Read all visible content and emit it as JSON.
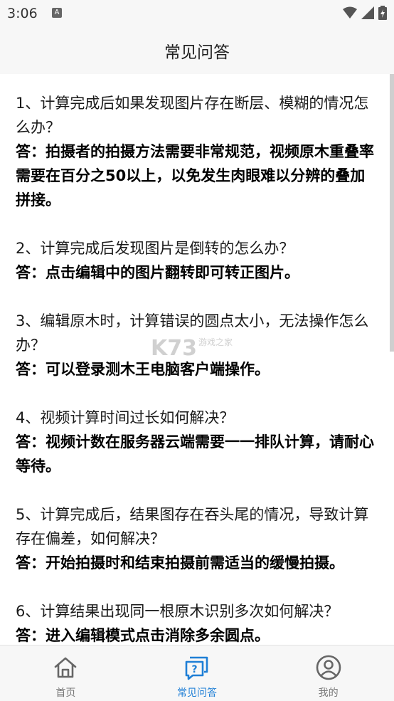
{
  "status": {
    "time": "3:06",
    "a_badge": "A"
  },
  "header": {
    "title": "常见问答"
  },
  "qa": [
    {
      "q": "1、计算完成后如果发现图片存在断层、模糊的情况怎么办？",
      "a": "答：拍摄者的拍摄方法需要非常规范，视频原木重叠率需要在百分之50以上，以免发生肉眼难以分辨的叠加拼接。"
    },
    {
      "q": "2、计算完成后发现图片是倒转的怎么办？",
      "a": "答：点击编辑中的图片翻转即可转正图片。"
    },
    {
      "q": "3、编辑原木时，计算错误的圆点太小，无法操作怎么办？",
      "a": "答：可以登录测木王电脑客户端操作。"
    },
    {
      "q": "4、视频计算时间过长如何解决？",
      "a": "答：视频计数在服务器云端需要一一排队计算，请耐心等待。"
    },
    {
      "q": "5、计算完成后，结果图存在吞头尾的情况，导致计算存在偏差，如何解决？",
      "a": "答：开始拍摄时和结束拍摄前需适当的缓慢拍摄。"
    },
    {
      "q": "6、计算结果出现同一根原木识别多次如何解决？",
      "a": "答：进入编辑模式点击消除多余圆点。"
    }
  ],
  "watermark": {
    "main": "K73",
    "sub": "游戏之家"
  },
  "nav": {
    "items": [
      {
        "label": "首页",
        "icon": "home-icon"
      },
      {
        "label": "常见问答",
        "icon": "faq-icon"
      },
      {
        "label": "我的",
        "icon": "profile-icon"
      }
    ],
    "active_color": "#1f7fd6",
    "inactive_color": "#777777"
  }
}
